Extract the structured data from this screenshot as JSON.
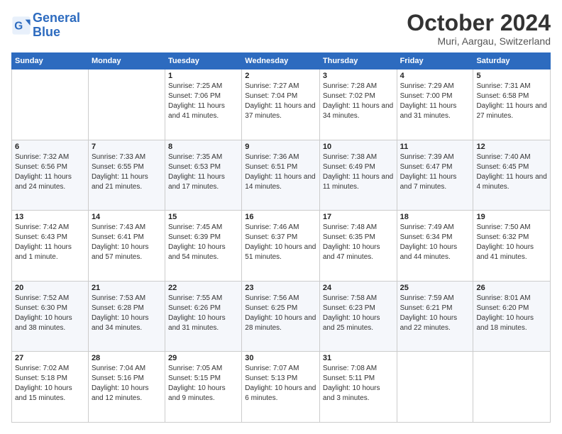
{
  "logo": {
    "line1": "General",
    "line2": "Blue"
  },
  "title": "October 2024",
  "location": "Muri, Aargau, Switzerland",
  "days_of_week": [
    "Sunday",
    "Monday",
    "Tuesday",
    "Wednesday",
    "Thursday",
    "Friday",
    "Saturday"
  ],
  "weeks": [
    [
      null,
      null,
      {
        "day": 1,
        "sunrise": "7:25 AM",
        "sunset": "7:06 PM",
        "daylight": "11 hours and 41 minutes."
      },
      {
        "day": 2,
        "sunrise": "7:27 AM",
        "sunset": "7:04 PM",
        "daylight": "11 hours and 37 minutes."
      },
      {
        "day": 3,
        "sunrise": "7:28 AM",
        "sunset": "7:02 PM",
        "daylight": "11 hours and 34 minutes."
      },
      {
        "day": 4,
        "sunrise": "7:29 AM",
        "sunset": "7:00 PM",
        "daylight": "11 hours and 31 minutes."
      },
      {
        "day": 5,
        "sunrise": "7:31 AM",
        "sunset": "6:58 PM",
        "daylight": "11 hours and 27 minutes."
      }
    ],
    [
      {
        "day": 6,
        "sunrise": "7:32 AM",
        "sunset": "6:56 PM",
        "daylight": "11 hours and 24 minutes."
      },
      {
        "day": 7,
        "sunrise": "7:33 AM",
        "sunset": "6:55 PM",
        "daylight": "11 hours and 21 minutes."
      },
      {
        "day": 8,
        "sunrise": "7:35 AM",
        "sunset": "6:53 PM",
        "daylight": "11 hours and 17 minutes."
      },
      {
        "day": 9,
        "sunrise": "7:36 AM",
        "sunset": "6:51 PM",
        "daylight": "11 hours and 14 minutes."
      },
      {
        "day": 10,
        "sunrise": "7:38 AM",
        "sunset": "6:49 PM",
        "daylight": "11 hours and 11 minutes."
      },
      {
        "day": 11,
        "sunrise": "7:39 AM",
        "sunset": "6:47 PM",
        "daylight": "11 hours and 7 minutes."
      },
      {
        "day": 12,
        "sunrise": "7:40 AM",
        "sunset": "6:45 PM",
        "daylight": "11 hours and 4 minutes."
      }
    ],
    [
      {
        "day": 13,
        "sunrise": "7:42 AM",
        "sunset": "6:43 PM",
        "daylight": "11 hours and 1 minute."
      },
      {
        "day": 14,
        "sunrise": "7:43 AM",
        "sunset": "6:41 PM",
        "daylight": "10 hours and 57 minutes."
      },
      {
        "day": 15,
        "sunrise": "7:45 AM",
        "sunset": "6:39 PM",
        "daylight": "10 hours and 54 minutes."
      },
      {
        "day": 16,
        "sunrise": "7:46 AM",
        "sunset": "6:37 PM",
        "daylight": "10 hours and 51 minutes."
      },
      {
        "day": 17,
        "sunrise": "7:48 AM",
        "sunset": "6:35 PM",
        "daylight": "10 hours and 47 minutes."
      },
      {
        "day": 18,
        "sunrise": "7:49 AM",
        "sunset": "6:34 PM",
        "daylight": "10 hours and 44 minutes."
      },
      {
        "day": 19,
        "sunrise": "7:50 AM",
        "sunset": "6:32 PM",
        "daylight": "10 hours and 41 minutes."
      }
    ],
    [
      {
        "day": 20,
        "sunrise": "7:52 AM",
        "sunset": "6:30 PM",
        "daylight": "10 hours and 38 minutes."
      },
      {
        "day": 21,
        "sunrise": "7:53 AM",
        "sunset": "6:28 PM",
        "daylight": "10 hours and 34 minutes."
      },
      {
        "day": 22,
        "sunrise": "7:55 AM",
        "sunset": "6:26 PM",
        "daylight": "10 hours and 31 minutes."
      },
      {
        "day": 23,
        "sunrise": "7:56 AM",
        "sunset": "6:25 PM",
        "daylight": "10 hours and 28 minutes."
      },
      {
        "day": 24,
        "sunrise": "7:58 AM",
        "sunset": "6:23 PM",
        "daylight": "10 hours and 25 minutes."
      },
      {
        "day": 25,
        "sunrise": "7:59 AM",
        "sunset": "6:21 PM",
        "daylight": "10 hours and 22 minutes."
      },
      {
        "day": 26,
        "sunrise": "8:01 AM",
        "sunset": "6:20 PM",
        "daylight": "10 hours and 18 minutes."
      }
    ],
    [
      {
        "day": 27,
        "sunrise": "7:02 AM",
        "sunset": "5:18 PM",
        "daylight": "10 hours and 15 minutes."
      },
      {
        "day": 28,
        "sunrise": "7:04 AM",
        "sunset": "5:16 PM",
        "daylight": "10 hours and 12 minutes."
      },
      {
        "day": 29,
        "sunrise": "7:05 AM",
        "sunset": "5:15 PM",
        "daylight": "10 hours and 9 minutes."
      },
      {
        "day": 30,
        "sunrise": "7:07 AM",
        "sunset": "5:13 PM",
        "daylight": "10 hours and 6 minutes."
      },
      {
        "day": 31,
        "sunrise": "7:08 AM",
        "sunset": "5:11 PM",
        "daylight": "10 hours and 3 minutes."
      },
      null,
      null
    ]
  ]
}
